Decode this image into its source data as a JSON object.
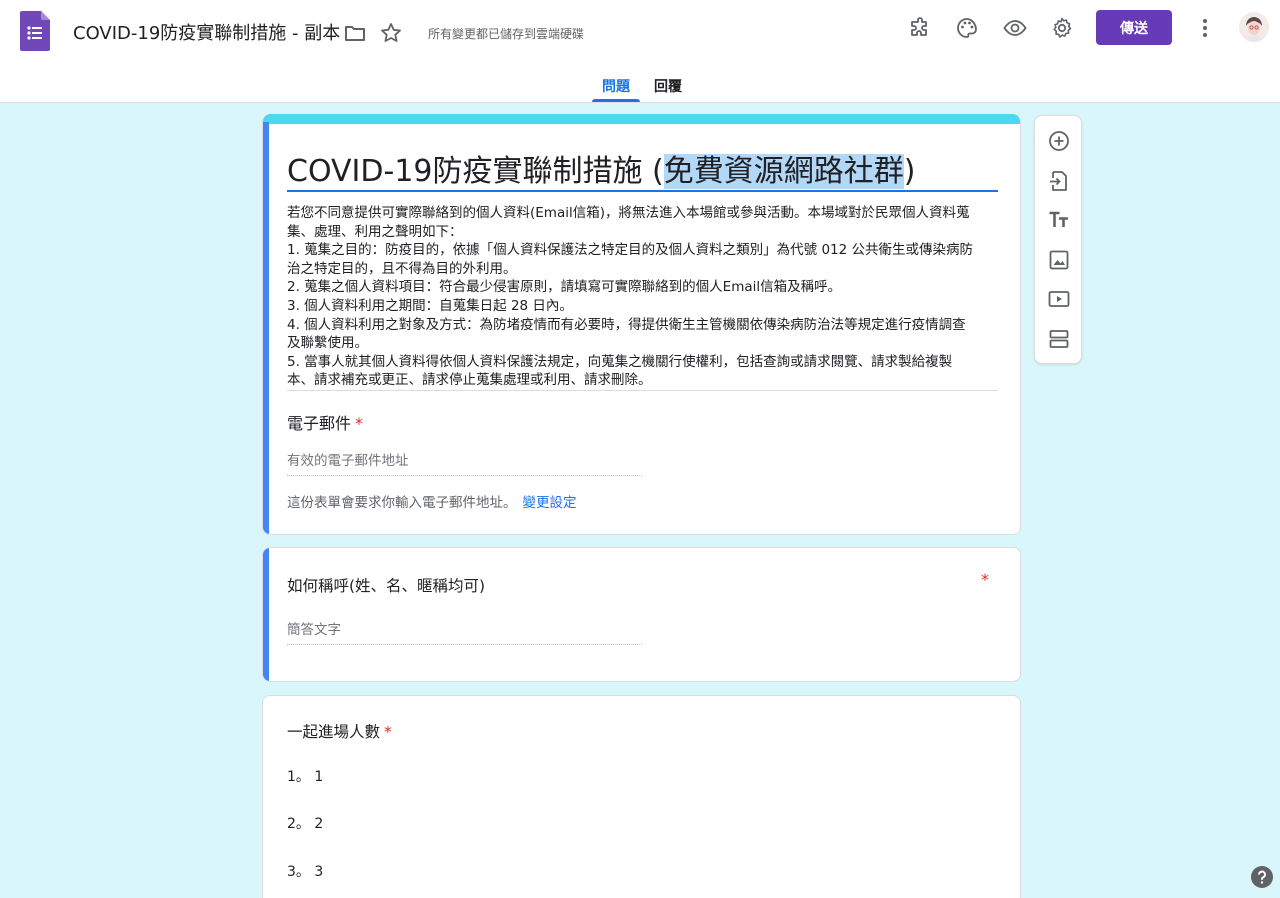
{
  "header": {
    "doc_title": "COVID-19防疫實聯制措施 - 副本",
    "save_status": "所有變更都已儲存到雲端硬碟",
    "send_label": "傳送",
    "icons": [
      "folder-icon",
      "star-icon",
      "addon-icon",
      "palette-icon",
      "preview-icon",
      "settings-icon",
      "more-vert-icon"
    ]
  },
  "tabs": {
    "questions": "問題",
    "responses": "回覆"
  },
  "form": {
    "title_main": "COVID-19防疫實聯制措施 (",
    "title_highlight": "免費資源網路社群",
    "title_end": ")",
    "description": [
      "若您不同意提供可實際聯絡到的個人資料(Email信箱)，將無法進入本場館或參與活動。本場域對於民眾個人資料蒐",
      "集、處理、利用之聲明如下：",
      "1. 蒐集之目的：防疫目的，依據「個人資料保護法之特定目的及個人資料之類別」為代號 012 公共衛生或傳染病防",
      "治之特定目的，且不得為目的外利用。",
      "2. 蒐集之個人資料項目：符合最少侵害原則，請填寫可實際聯絡到的個人Email信箱及稱呼。",
      "3. 個人資料利用之期間：自蒐集日起 28 日內。",
      "4. 個人資料利用之對象及方式：為防堵疫情而有必要時，得提供衛生主管機關依傳染病防治法等規定進行疫情調查",
      "及聯繫使用。",
      "5. 當事人就其個人資料得依個人資料保護法規定，向蒐集之機關行使權利，包括查詢或請求閱覽、請求製給複製",
      "本、請求補充或更正、請求停止蒐集處理或利用、請求刪除。"
    ],
    "email_label": "電子郵件",
    "email_placeholder": "有效的電子郵件地址",
    "email_note": "這份表單會要求你輸入電子郵件地址。",
    "email_change": "變更設定",
    "required_mark": "*"
  },
  "questions": [
    {
      "label": "如何稱呼(姓、名、暱稱均可)",
      "placeholder": "簡答文字"
    },
    {
      "label": "一起進場人數",
      "options": [
        "1。 1",
        "2。 2",
        "3。 3"
      ]
    }
  ],
  "toolbar": [
    "add-question-icon",
    "import-questions-icon",
    "add-title-icon",
    "add-image-icon",
    "add-video-icon",
    "add-section-icon"
  ],
  "colors": {
    "accent": "#673ab7",
    "theme_band": "#4dd8f2",
    "page_bg": "#d9f6fb",
    "active_tab": "#1a73e8",
    "required": "#d93025"
  }
}
